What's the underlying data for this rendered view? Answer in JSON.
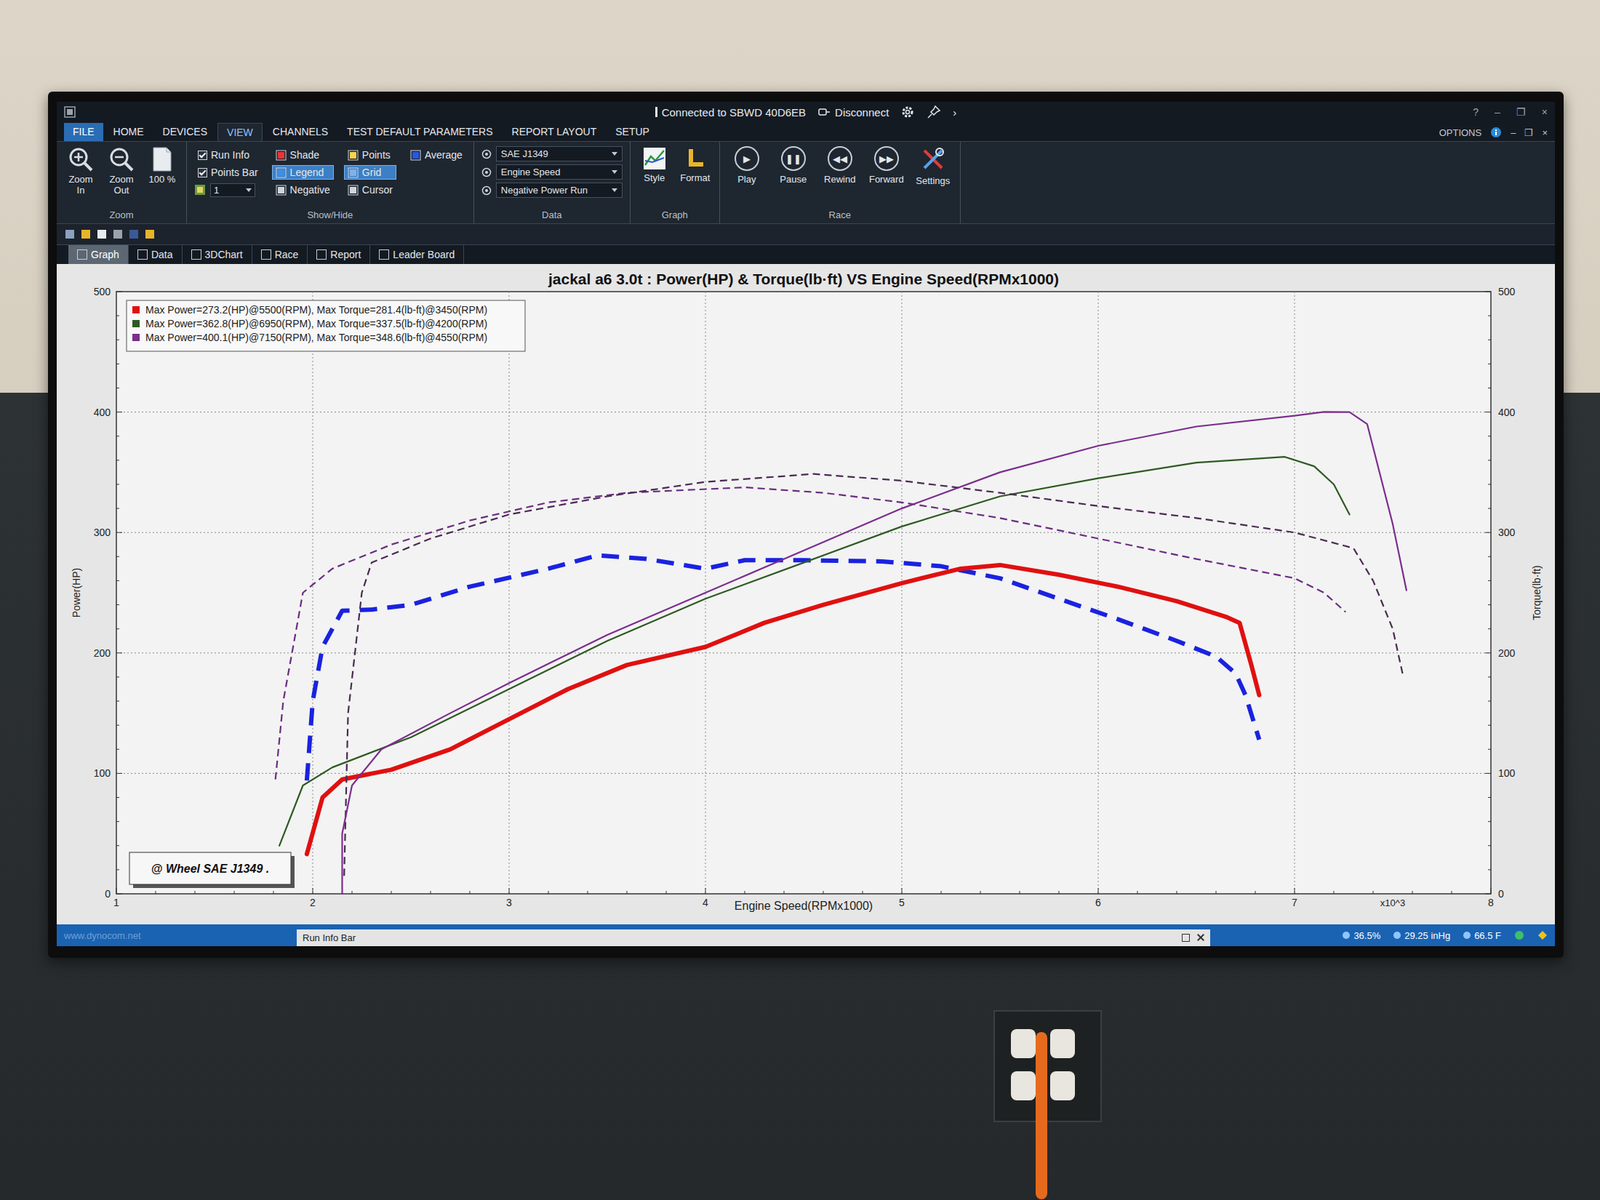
{
  "window": {
    "title": "Connected to SBWD 40D6EB",
    "disconnect": "Disconnect",
    "more": "›",
    "controls": [
      "?",
      "–",
      "❐",
      "×"
    ],
    "doc_controls": [
      "–",
      "❐",
      "×"
    ],
    "options": "OPTIONS"
  },
  "menu_tabs": [
    {
      "label": "FILE",
      "selected": false
    },
    {
      "label": "HOME",
      "selected": false
    },
    {
      "label": "DEVICES",
      "selected": false
    },
    {
      "label": "VIEW",
      "selected": true
    },
    {
      "label": "CHANNELS",
      "selected": false
    },
    {
      "label": "TEST DEFAULT PARAMETERS",
      "selected": false
    },
    {
      "label": "REPORT LAYOUT",
      "selected": false
    },
    {
      "label": "SETUP",
      "selected": false
    }
  ],
  "ribbon": {
    "zoom": {
      "label": "Zoom",
      "buttons": [
        "Zoom In",
        "Zoom Out",
        "100 %"
      ]
    },
    "show_hide": {
      "label": "Show/Hide",
      "items": [
        {
          "label": "Run Info",
          "kind": "checkbox",
          "checked": true
        },
        {
          "label": "Points Bar",
          "kind": "checkbox",
          "checked": true
        },
        {
          "label": "1",
          "kind": "spinner"
        },
        {
          "label": "Shade",
          "kind": "toggle",
          "selected": false
        },
        {
          "label": "Legend",
          "kind": "toggle",
          "selected": true
        },
        {
          "label": "Negative",
          "kind": "toggle",
          "selected": false
        },
        {
          "label": "Points",
          "kind": "toggle",
          "selected": false
        },
        {
          "label": "Grid",
          "kind": "toggle",
          "selected": true
        },
        {
          "label": "Cursor",
          "kind": "toggle",
          "selected": false
        },
        {
          "label": "Average",
          "kind": "toggle",
          "selected": false
        }
      ]
    },
    "data": {
      "label": "Data",
      "dropdowns": [
        "SAE J1349",
        "Engine Speed",
        "Negative Power Run"
      ]
    },
    "graph": {
      "label": "Graph",
      "buttons": [
        "Style",
        "Format"
      ]
    },
    "race": {
      "label": "Race",
      "buttons": [
        {
          "label": "Play",
          "glyph": "▶"
        },
        {
          "label": "Pause",
          "glyph": "❚❚"
        },
        {
          "label": "Rewind",
          "glyph": "◀◀"
        },
        {
          "label": "Forward",
          "glyph": "▶▶"
        }
      ],
      "settings": "Settings"
    }
  },
  "doc_tabs": [
    {
      "label": "Graph",
      "selected": true
    },
    {
      "label": "Data",
      "selected": false
    },
    {
      "label": "3DChart",
      "selected": false
    },
    {
      "label": "Race",
      "selected": false
    },
    {
      "label": "Report",
      "selected": false
    },
    {
      "label": "Leader Board",
      "selected": false
    }
  ],
  "chart": {
    "title": "jackal a6 3.0t : Power(HP) & Torque(lb·ft) VS Engine Speed(RPMx1000)",
    "y_label_left": "Power(HP)",
    "y_label_right": "Torque(lb·ft)",
    "x_label": "Engine Speed(RPMx1000)",
    "y_ticks_left": [
      "0",
      "100",
      "200",
      "300",
      "400",
      "500"
    ],
    "y_ticks_right": [
      "0",
      "100",
      "200",
      "300",
      "400",
      "500"
    ],
    "x_ticks": [
      "1",
      "2",
      "3",
      "4",
      "5",
      "6",
      "7",
      "8"
    ],
    "x_multiplier": "x10^3",
    "watermark": "@ Wheel SAE J1349  .",
    "series": [
      {
        "legend": "Max Power=273.2(HP)@5500(RPM), Max Torque=281.4(lb-ft)@3450(RPM)",
        "color": "#e01010",
        "torque_color": "#1a22e0",
        "emphasized": true,
        "power": {
          "rpm": [
            1.97,
            2.05,
            2.15,
            2.4,
            2.7,
            3.0,
            3.3,
            3.6,
            4.0,
            4.3,
            4.6,
            5.0,
            5.3,
            5.5,
            5.8,
            6.1,
            6.4,
            6.65,
            6.72,
            6.78,
            6.82
          ],
          "values": [
            33,
            80,
            95,
            103,
            120,
            145,
            170,
            190,
            205,
            225,
            240,
            258,
            270,
            273,
            265,
            255,
            243,
            230,
            225,
            190,
            165
          ]
        },
        "torque": {
          "rpm": [
            1.97,
            2.0,
            2.05,
            2.15,
            2.3,
            2.5,
            2.8,
            3.2,
            3.45,
            3.7,
            4.0,
            4.2,
            4.5,
            4.9,
            5.2,
            5.5,
            5.8,
            6.1,
            6.4,
            6.6,
            6.7,
            6.75,
            6.82
          ],
          "values": [
            94,
            160,
            205,
            235,
            236,
            240,
            255,
            270,
            281,
            278,
            270,
            277,
            277,
            276,
            272,
            262,
            245,
            228,
            210,
            197,
            183,
            165,
            128
          ]
        }
      },
      {
        "legend": "Max Power=362.8(HP)@6950(RPM), Max Torque=337.5(lb-ft)@4200(RPM)",
        "color": "#2e5a22",
        "torque_color": "#6a2d80",
        "emphasized": false,
        "power": {
          "rpm": [
            1.83,
            1.95,
            2.1,
            2.5,
            3.0,
            3.5,
            4.0,
            4.5,
            5.0,
            5.5,
            6.0,
            6.5,
            6.95,
            7.1,
            7.2,
            7.28
          ],
          "values": [
            40,
            90,
            105,
            130,
            170,
            210,
            245,
            275,
            305,
            330,
            345,
            358,
            362.8,
            355,
            340,
            315
          ]
        },
        "torque": {
          "rpm": [
            1.81,
            1.85,
            1.95,
            2.1,
            2.4,
            2.8,
            3.2,
            3.6,
            4.2,
            4.6,
            5.0,
            5.5,
            6.0,
            6.5,
            7.0,
            7.15,
            7.26
          ],
          "values": [
            95,
            160,
            250,
            270,
            290,
            310,
            325,
            333,
            337.5,
            333,
            325,
            312,
            295,
            278,
            262,
            250,
            234
          ]
        }
      },
      {
        "legend": "Max Power=400.1(HP)@7150(RPM), Max Torque=348.6(lb-ft)@4550(RPM)",
        "color": "#7b2d8e",
        "torque_color": "#4a2a52",
        "emphasized": false,
        "power": {
          "rpm": [
            2.15,
            2.15,
            2.2,
            2.35,
            2.7,
            3.0,
            3.5,
            4.0,
            4.5,
            5.0,
            5.5,
            6.0,
            6.5,
            7.0,
            7.15,
            7.28,
            7.37,
            7.5,
            7.57
          ],
          "values": [
            0,
            50,
            90,
            120,
            150,
            175,
            215,
            250,
            285,
            320,
            350,
            372,
            388,
            397,
            400.1,
            400,
            390,
            307,
            252
          ]
        },
        "torque": {
          "rpm": [
            2.16,
            2.18,
            2.25,
            2.3,
            2.6,
            3.0,
            3.5,
            4.0,
            4.55,
            5.0,
            5.5,
            6.0,
            6.5,
            7.0,
            7.3,
            7.4,
            7.5,
            7.55
          ],
          "values": [
            15,
            150,
            250,
            275,
            295,
            315,
            330,
            342,
            348.6,
            343,
            333,
            322,
            312,
            300,
            287,
            260,
            220,
            183
          ]
        }
      }
    ]
  },
  "status_bar": {
    "link": "www.dynocom.net",
    "panel": "Run Info Bar",
    "humidity": "36.5%",
    "pressure": "29.25 inHg",
    "temperature": "66.5 F"
  }
}
